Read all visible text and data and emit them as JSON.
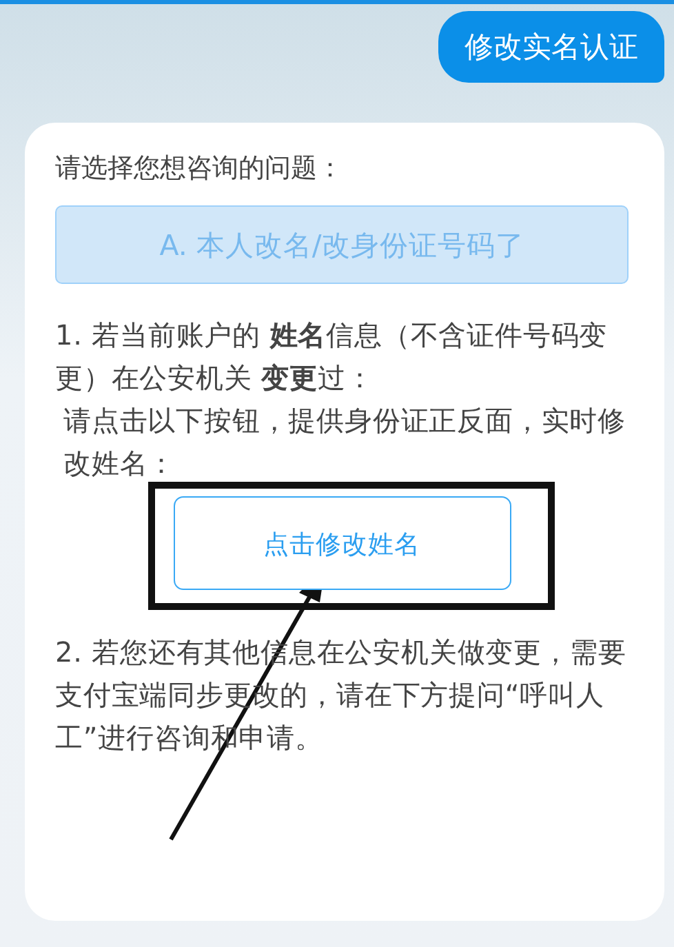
{
  "bubble": {
    "text": "修改实名认证"
  },
  "card": {
    "prompt": "请选择您想咨询的问题：",
    "option": {
      "label": "A. 本人改名/改身份证号码了",
      "selected": true
    },
    "step1": [
      "1. 若当前账户的 **姓名**信息（不含证件号码变更）在公安机关 **变更**过：",
      "请点击以下按钮，提供身份证正反面，实时修改姓名："
    ],
    "action": {
      "label": "点击修改姓名"
    },
    "step2": "2. 若您还有其他信息在公安机关做变更，需要支付宝端同步更改的，请在下方提问“呼叫人工”进行咨询和申请。"
  }
}
